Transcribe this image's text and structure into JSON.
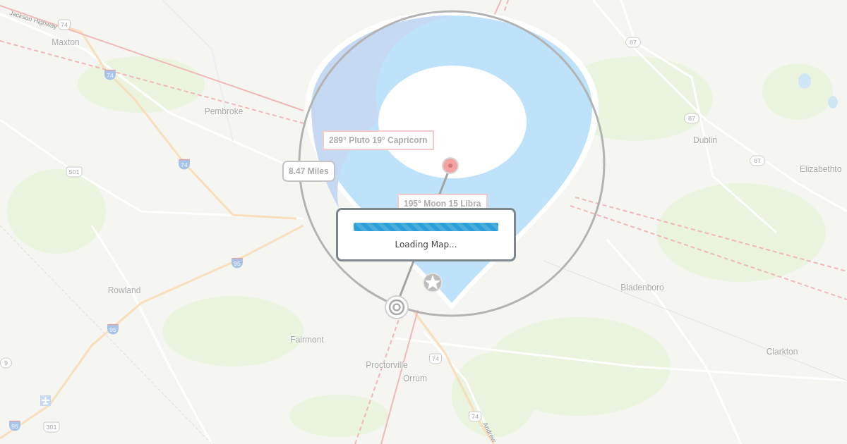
{
  "map": {
    "places": [
      {
        "name": "Maxton"
      },
      {
        "name": "Pembroke"
      },
      {
        "name": "Rowland"
      },
      {
        "name": "Fairmont"
      },
      {
        "name": "Proctorville"
      },
      {
        "name": "Orrum"
      },
      {
        "name": "Dublin"
      },
      {
        "name": "Elizabethto"
      },
      {
        "name": "Bladenboro"
      },
      {
        "name": "Clarkton"
      }
    ],
    "road_names": [
      {
        "text": "Jackson Highway"
      },
      {
        "text": "Andrew"
      }
    ],
    "road_shields": [
      {
        "number": "74",
        "kind": "us"
      },
      {
        "number": "74",
        "kind": "interstate"
      },
      {
        "number": "501",
        "kind": "us"
      },
      {
        "number": "74",
        "kind": "interstate"
      },
      {
        "number": "95",
        "kind": "interstate"
      },
      {
        "number": "95",
        "kind": "interstate"
      },
      {
        "number": "9",
        "kind": "state"
      },
      {
        "number": "95",
        "kind": "interstate"
      },
      {
        "number": "301",
        "kind": "us"
      },
      {
        "number": "87",
        "kind": "state"
      },
      {
        "number": "87",
        "kind": "state"
      },
      {
        "number": "87",
        "kind": "state"
      },
      {
        "number": "74",
        "kind": "us"
      },
      {
        "number": "74",
        "kind": "us"
      }
    ]
  },
  "overlay": {
    "distance_label": "8.47 Miles",
    "planet_labels": [
      {
        "text": "289° Pluto 19° Capricorn"
      },
      {
        "text": "195° Moon 15 Libra"
      }
    ]
  },
  "loading": {
    "message": "Loading Map...",
    "level": 1
  }
}
